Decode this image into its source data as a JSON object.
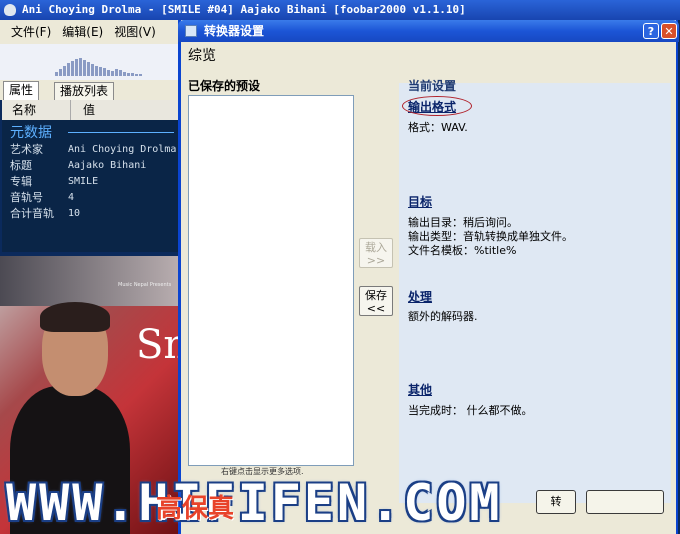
{
  "main_window": {
    "title": "Ani Choying Drolma - [SMILE #04] Aajako Bihani    [foobar2000 v1.1.10]",
    "menu": [
      "文件(F)",
      "编辑(E)",
      "视图(V)"
    ],
    "tabs": [
      "属性",
      "播放列表"
    ],
    "props_header": {
      "name_col": "名称",
      "value_col": "值"
    },
    "metadata_title": "元数据",
    "metadata": [
      {
        "key": "艺术家",
        "value": "Ani Choying Drolma"
      },
      {
        "key": "标题",
        "value": "Aajako Bihani"
      },
      {
        "key": "专辑",
        "value": "SMILE"
      },
      {
        "key": "音轨号",
        "value": "4"
      },
      {
        "key": "合计音轨",
        "value": "10"
      }
    ],
    "album_art": {
      "text": "Sm",
      "label": "Music Nepal Presents"
    }
  },
  "dialog": {
    "title": "转换器设置",
    "overview_heading": "综览",
    "saved_presets_label": "已保存的预设",
    "right_click_hint": "右键点击显示更多选项.",
    "load_button": {
      "line1": "载入",
      "line2": ">>"
    },
    "save_button": {
      "line1": "保存",
      "line2": "<<"
    },
    "current_settings_label": "当前设置",
    "sections": {
      "output_format": {
        "title": "输出格式",
        "lines": [
          "格式：WAV."
        ]
      },
      "destination": {
        "title": "目标",
        "lines": [
          "输出目录：稍后询问。",
          "输出类型：音轨转换成单独文件。",
          "文件名模板：%title%"
        ]
      },
      "processing": {
        "title": "处理",
        "lines": [
          "额外的解码器."
        ]
      },
      "other": {
        "title": "其他",
        "lines": [
          "当完成时： 什么都不做。"
        ]
      }
    },
    "ok_fragment": "转"
  },
  "watermark": {
    "text": "WWW.HIFIFEN.COM",
    "cn": "高保真"
  },
  "colors": {
    "dialog_title": "#1c55d6",
    "highlight_ellipse": "#b0212a",
    "metadata_heading": "#5db0ff"
  }
}
